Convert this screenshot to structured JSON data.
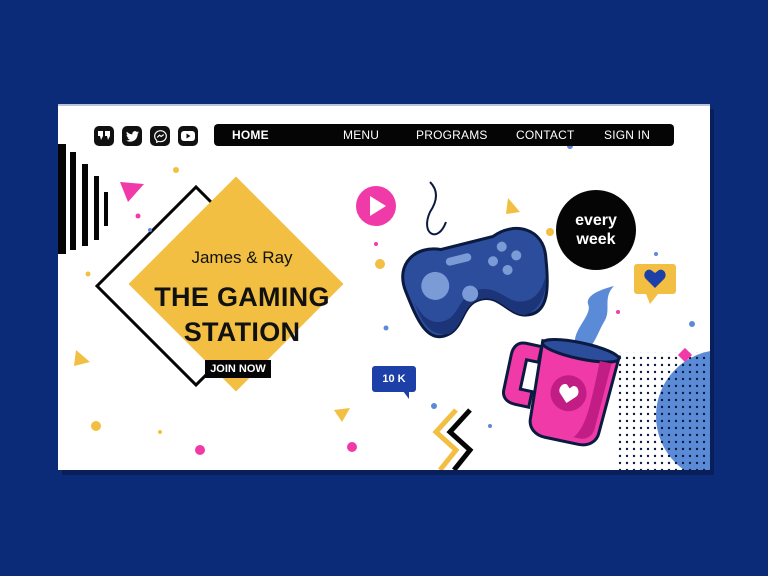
{
  "social": {
    "icons": [
      "quote-icon",
      "twitter-icon",
      "messenger-icon",
      "youtube-icon"
    ]
  },
  "nav": {
    "items": [
      "HOME",
      "MENU",
      "PROGRAMS",
      "CONTACT",
      "SIGN IN"
    ],
    "active": "HOME"
  },
  "hero": {
    "subtitle": "James & Ray",
    "title_line1": "THE GAMING",
    "title_line2": "STATION",
    "cta": "JOIN NOW"
  },
  "badges": {
    "every_line1": "every",
    "every_line2": "week",
    "count": "10 K"
  },
  "colors": {
    "background": "#0b2a78",
    "yellow": "#f2bf42",
    "pink": "#f03aa8",
    "blue": "#2b4d9c",
    "light_blue": "#5b8bd6"
  }
}
